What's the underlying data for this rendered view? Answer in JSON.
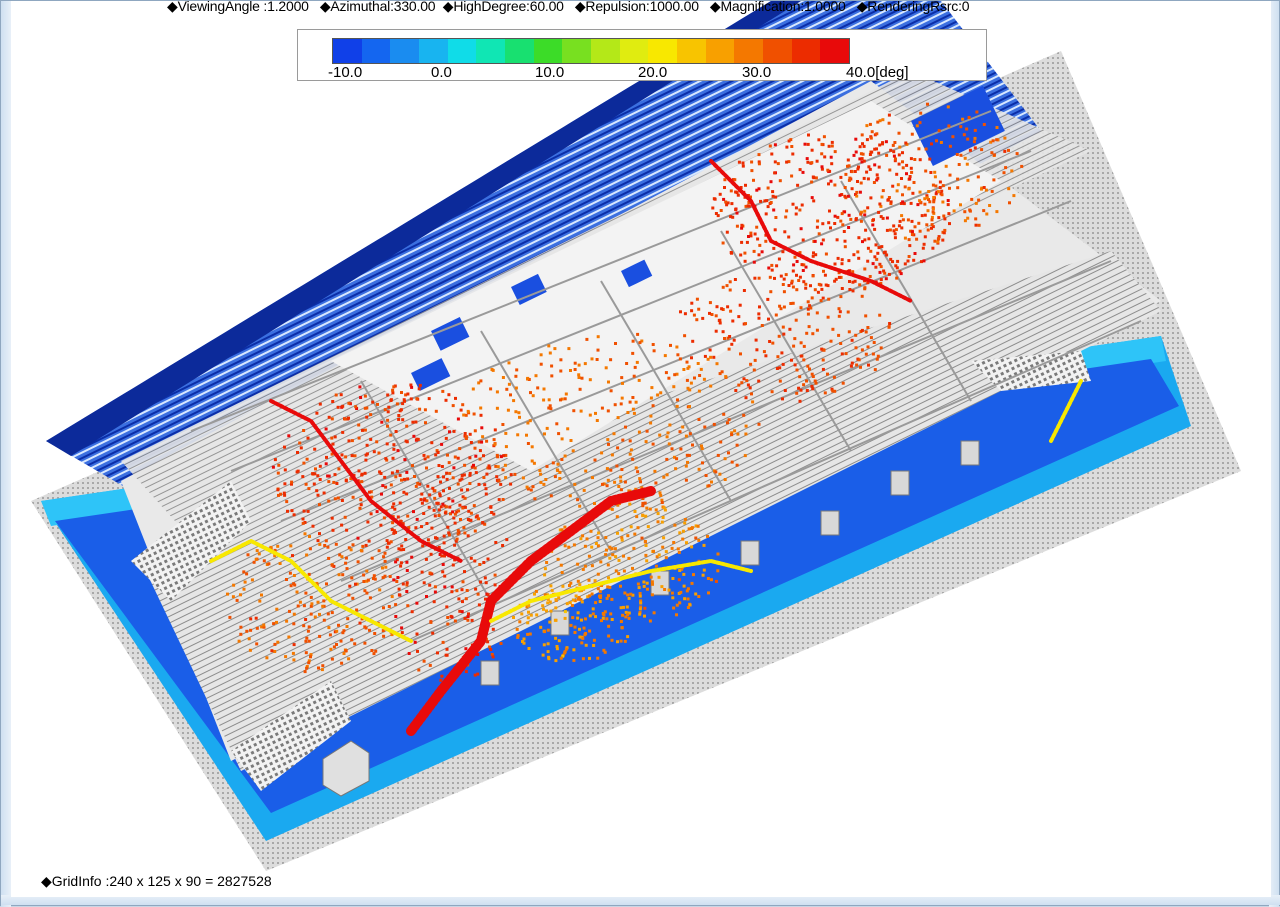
{
  "status_bar": {
    "viewing_angle": "◆ViewingAngle :1.2000",
    "azimuthal": "◆Azimuthal:330.00",
    "high_degree": "◆HighDegree:60.00",
    "repulsion": "◆Repulsion:1000.00",
    "magnification": "◆Magnification:1.0000",
    "rendering_rsrc": "◆RenderingRsrc:0"
  },
  "colorbar": {
    "ticks": [
      "-10.0",
      "0.0",
      "10.0",
      "20.0",
      "30.0",
      "40.0[deg]"
    ],
    "colors": [
      "#1040e8",
      "#1466f0",
      "#1a8cf0",
      "#18b4f0",
      "#10dce8",
      "#10e6b4",
      "#18e070",
      "#3cdc28",
      "#78e020",
      "#b4e818",
      "#e0ec10",
      "#f8e800",
      "#f8c400",
      "#f8a000",
      "#f47800",
      "#f05000",
      "#ec2c00",
      "#e80a0a"
    ]
  },
  "footer": {
    "grid_info": "◆GridInfo :240 x 125 x 90 = 2827528"
  }
}
